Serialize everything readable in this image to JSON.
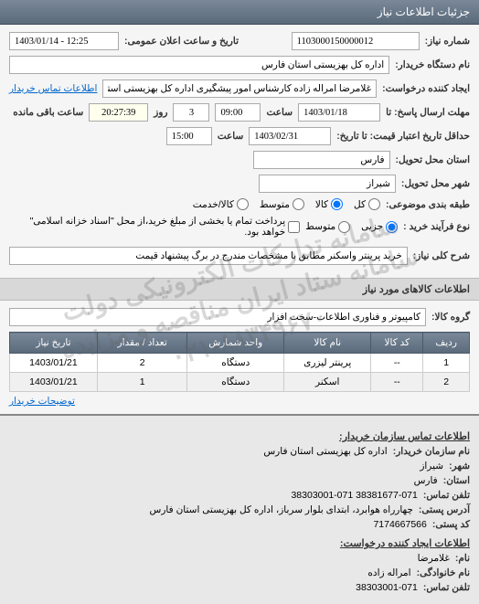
{
  "header": {
    "title": "جزئیات اطلاعات نیاز"
  },
  "form": {
    "need_number_label": "شماره نیاز:",
    "need_number": "1103000150000012",
    "public_date_label": "تاریخ و ساعت اعلان عمومی:",
    "public_date": "1403/01/14 - 12:25",
    "buyer_org_label": "نام دستگاه خریدار:",
    "buyer_org": "اداره کل بهزیستی استان فارس",
    "requester_label": "ایجاد کننده درخواست:",
    "requester": "غلامرضا امراله زاده کارشناس امور پیشگیری اداره کل بهزیستی استان فارس",
    "buyer_contact_link": "اطلاعات تماس خریدار",
    "response_deadline_label": "مهلت ارسال پاسخ: تا",
    "response_date": "1403/01/18",
    "response_time_label": "ساعت",
    "response_time": "09:00",
    "days_left": "3",
    "days_left_unit": "روز",
    "time_left": "20:27:39",
    "time_left_unit": "ساعت باقی مانده",
    "price_validity_label": "حداقل تاریخ اعتبار قیمت: تا تاریخ:",
    "price_validity_date": "1403/02/31",
    "price_validity_time_label": "ساعت",
    "price_validity_time": "15:00",
    "delivery_province_label": "استان محل تحویل:",
    "delivery_province": "فارس",
    "delivery_city_label": "شهر محل تحویل:",
    "delivery_city": "شیراز",
    "topic_category_label": "طبقه بندی موضوعی:",
    "radio_all": "کل",
    "radio_goods": "کالا",
    "radio_goods_service": "کالا/خدمت",
    "radio_medium": "متوسط",
    "purchase_type_label": "نوع فرآیند خرید :",
    "radio_micro": "جزیی",
    "pay_note": "پرداخت تمام یا بخشی از مبلغ خرید،از محل \"اسناد خزانه اسلامی\" خواهد بود.",
    "need_summary_label": "شرح کلی نیاز:",
    "need_summary": "خرید پرینتر واسکنر مطابق با مشخصات مندرج در برگ پیشنهاد قیمت"
  },
  "goods_section": {
    "title": "اطلاعات کالاهای مورد نیاز",
    "group_label": "گروه کالا:",
    "group_value": "کامپیوتر و فناوری اطلاعات-سخت افزار"
  },
  "table": {
    "headers": {
      "row": "ردیف",
      "code": "کد کالا",
      "name": "نام کالا",
      "order_unit": "واحد شمارش",
      "qty": "تعداد / مقدار",
      "date": "تاریخ نیاز"
    },
    "rows": [
      {
        "idx": "1",
        "code": "--",
        "name": "پرینتر لیزری",
        "unit": "دستگاه",
        "qty": "2",
        "date": "1403/01/21"
      },
      {
        "idx": "2",
        "code": "--",
        "name": "اسکنر",
        "unit": "دستگاه",
        "qty": "1",
        "date": "1403/01/21"
      }
    ]
  },
  "specs_link": "توضیحات خریدار",
  "contact": {
    "title": "اطلاعات تماس سازمان خریدار:",
    "org_label": "نام سازمان خریدار:",
    "org": "اداره کل بهزیستی استان فارس",
    "city_label": "شهر:",
    "city": "شیراز",
    "province_label": "استان:",
    "province": "فارس",
    "phone_label": "تلفن تماس:",
    "phone": "38381677-071 38303001-071",
    "address_label": "آدرس پستی:",
    "address": "چهارراه هوابرد، ابتدای بلوار سرباز، اداره کل بهزیستی استان فارس",
    "postal_label": "کد پستی:",
    "postal": "7174667566",
    "requester_title": "اطلاعات ایجاد کننده درخواست:",
    "name_label": "نام:",
    "name": "غلامرضا",
    "family_label": "نام خانوادگی:",
    "family": "امراله زاده",
    "phone2_label": "تلفن تماس:",
    "phone2": "38303001-071"
  },
  "watermark": {
    "line1": "سامانه تدارکات الکترونیکی دولت",
    "line2": "سامانه ستاد ایران مناقصه و مزایده",
    "line3": "۰۲۱-۸۸۳۴۹۶۷۰"
  }
}
